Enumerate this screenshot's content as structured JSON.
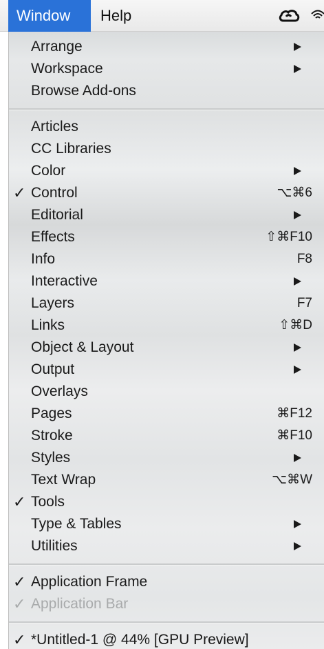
{
  "menubar": {
    "window_label": "Window",
    "help_label": "Help",
    "icons": [
      "creative-cloud-icon",
      "wifi-icon"
    ]
  },
  "menu": {
    "groups": [
      [
        {
          "label": "Arrange",
          "submenu": true
        },
        {
          "label": "Workspace",
          "submenu": true
        },
        {
          "label": "Browse Add-ons"
        }
      ],
      [
        {
          "label": "Articles"
        },
        {
          "label": "CC Libraries"
        },
        {
          "label": "Color",
          "submenu": true
        },
        {
          "label": "Control",
          "checked": true,
          "shortcut": "⌥⌘6"
        },
        {
          "label": "Editorial",
          "submenu": true
        },
        {
          "label": "Effects",
          "shortcut": "⇧⌘F10"
        },
        {
          "label": "Info",
          "shortcut": "F8"
        },
        {
          "label": "Interactive",
          "submenu": true
        },
        {
          "label": "Layers",
          "shortcut": "F7"
        },
        {
          "label": "Links",
          "shortcut": "⇧⌘D"
        },
        {
          "label": "Object & Layout",
          "submenu": true
        },
        {
          "label": "Output",
          "submenu": true
        },
        {
          "label": "Overlays"
        },
        {
          "label": "Pages",
          "shortcut": "⌘F12"
        },
        {
          "label": "Stroke",
          "shortcut": "⌘F10"
        },
        {
          "label": "Styles",
          "submenu": true
        },
        {
          "label": "Text Wrap",
          "shortcut": "⌥⌘W"
        },
        {
          "label": "Tools",
          "checked": true
        },
        {
          "label": "Type & Tables",
          "submenu": true
        },
        {
          "label": "Utilities",
          "submenu": true
        }
      ],
      [
        {
          "label": "Application Frame",
          "checked": true
        },
        {
          "label": "Application Bar",
          "checked": true,
          "disabled": true
        }
      ],
      [
        {
          "label": "*Untitled-1 @ 44% [GPU Preview]",
          "checked": true
        }
      ]
    ],
    "check_glyph": "✓"
  }
}
